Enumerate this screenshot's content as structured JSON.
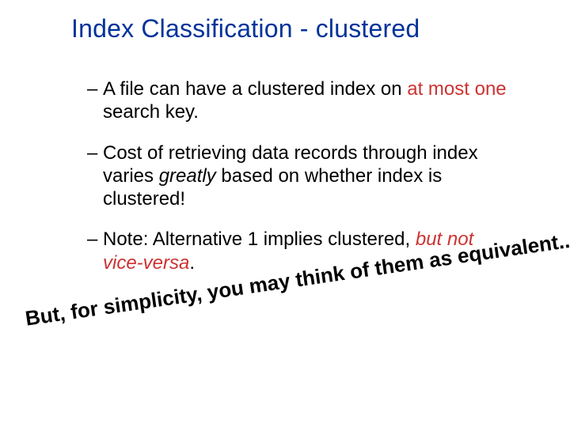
{
  "title": "Index Classification - clustered",
  "bullets": [
    {
      "pre": "A file can have a clustered index on ",
      "em": "at most one",
      "post": " search key."
    },
    {
      "pre": "Cost of retrieving data records through index varies ",
      "em": "greatly",
      "post": " based on whether index is clustered!"
    },
    {
      "pre": "Note: Alternative 1 implies clustered, ",
      "em": "but not vice-versa",
      "post": "."
    }
  ],
  "annotation": "But, for simplicity, you may think of them as equivalent.."
}
